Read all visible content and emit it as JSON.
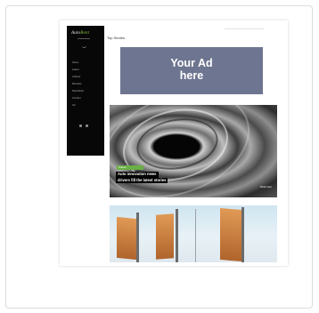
{
  "card": {
    "preview": {
      "site_name": "Auto",
      "site_name_accent": "Rent",
      "nav_items": [
        "Home",
        "Latest",
        "Articles",
        "Reviews",
        "Newsletter",
        "Contact",
        "Ad"
      ],
      "page_title": "Top Stories",
      "ad_box": {
        "line1": "Your Ad",
        "line2": "here",
        "color": "#6e7590"
      },
      "featured_article": {
        "category": "Feature",
        "headline_line1": "Auto innovation news",
        "headline_line2": "drivers fill the latest stories",
        "read_more": "Read more",
        "accent_color": "#6ab046"
      }
    }
  }
}
